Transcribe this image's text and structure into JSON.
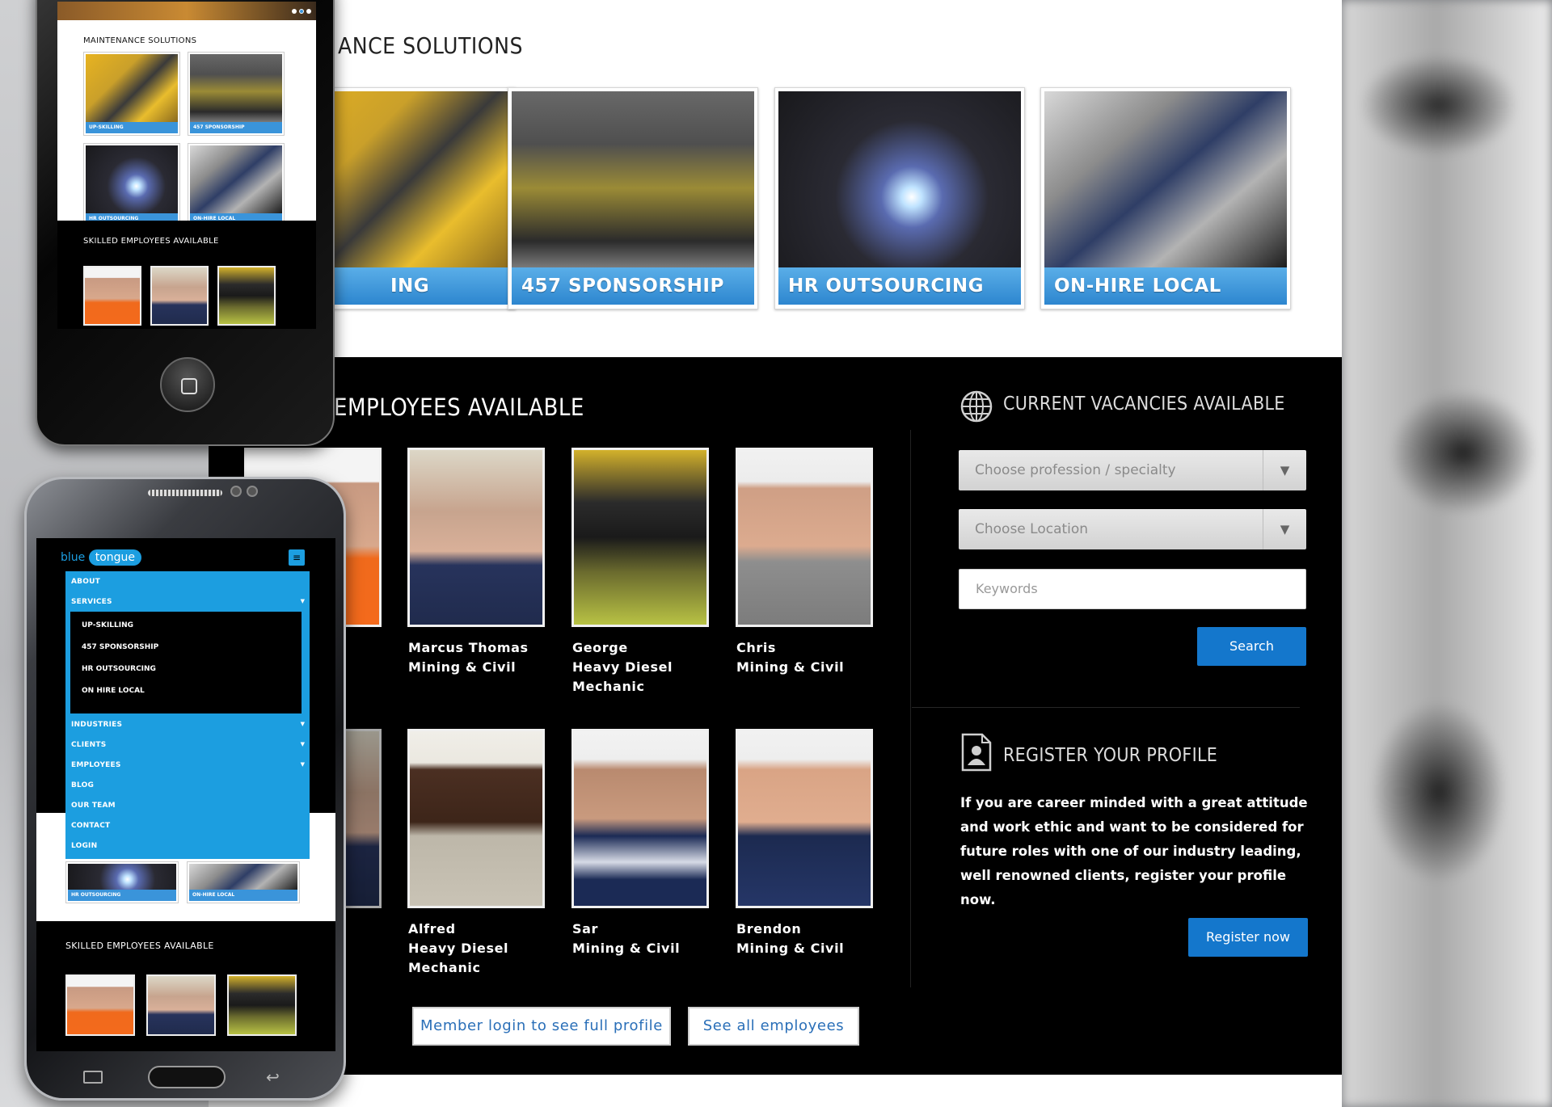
{
  "maintenance": {
    "title": "ANCE SOLUTIONS",
    "cards": [
      {
        "label": "ING",
        "image": "up-skilling-photo"
      },
      {
        "label": "457 SPONSORSHIP",
        "image": "457-sponsorship-photo"
      },
      {
        "label": "HR OUTSOURCING",
        "image": "hr-outsourcing-photo"
      },
      {
        "label": "ON-HIRE LOCAL",
        "image": "on-hire-local-photo"
      }
    ]
  },
  "employees": {
    "title": "EMPLOYEES AVAILABLE",
    "list": [
      {
        "line1": "Marcus Thomas",
        "line2": "Mining & Civil",
        "line3": ""
      },
      {
        "line1": "George",
        "line2": "Heavy Diesel",
        "line3": "Mechanic"
      },
      {
        "line1": "Chris",
        "line2": "Mining & Civil",
        "line3": ""
      },
      {
        "line1": "Alfred",
        "line2": "Heavy Diesel",
        "line3": "Mechanic"
      },
      {
        "line1": "Sar",
        "line2": "Mining & Civil",
        "line3": ""
      },
      {
        "line1": "Brendon",
        "line2": "Mining & Civil",
        "line3": ""
      }
    ],
    "member_login_label": "Member login to see full profile",
    "see_all_label": "See all employees"
  },
  "vacancies": {
    "title": "CURRENT VACANCIES AVAILABLE",
    "profession_placeholder": "Choose profession / specialty",
    "location_placeholder": "Choose Location",
    "keywords_placeholder": "Keywords",
    "search_label": "Search",
    "arrow": "▼"
  },
  "register": {
    "title": "REGISTER YOUR PROFILE",
    "text": "If you are career minded with a great attitude and work ethic and want to be considered for future roles with one of our industry leading, well renowned clients, register your profile now.",
    "button_label": "Register now"
  },
  "iphone": {
    "maint_title": "MAINTENANCE SOLUTIONS",
    "cards": [
      "UP-SKILLING",
      "457 SPONSORSHIP",
      "HR OUTSOURCING",
      "ON-HIRE LOCAL"
    ],
    "skilled_title": "SKILLED EMPLOYEES AVAILABLE"
  },
  "samsung": {
    "logo_blue": "blue",
    "logo_tongue": "tongue",
    "menu": {
      "about": "ABOUT",
      "services": "SERVICES",
      "sub": [
        "UP-SKILLING",
        "457 SPONSORSHIP",
        "HR OUTSOURCING",
        "ON HIRE LOCAL"
      ],
      "industries": "INDUSTRIES",
      "clients": "CLIENTS",
      "employees": "EMPLOYEES",
      "blog": "BLOG",
      "our_team": "OUR TEAM",
      "contact": "CONTACT",
      "login": "LOGIN"
    },
    "cards": [
      "HR OUTSOURCING",
      "ON-HIRE LOCAL"
    ],
    "skilled_title": "SKILLED EMPLOYEES AVAILABLE"
  },
  "colors": {
    "accent": "#1477cc",
    "caption": "#3a94da",
    "menu": "#1c9ee0"
  }
}
